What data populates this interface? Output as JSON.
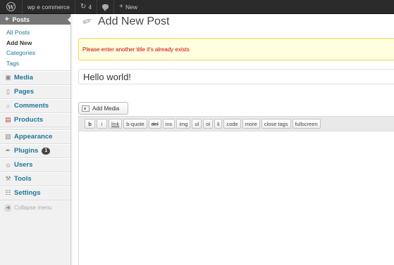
{
  "adminbar": {
    "site_name": "wp e commerce",
    "updates_count": "4",
    "new_label": "New"
  },
  "sidebar": {
    "posts_label": "Posts",
    "posts_submenu": [
      {
        "label": "All Posts"
      },
      {
        "label": "Add New"
      },
      {
        "label": "Categories"
      },
      {
        "label": "Tags"
      }
    ],
    "items": [
      {
        "label": "Media",
        "icon": "media-icon"
      },
      {
        "label": "Pages",
        "icon": "pages-icon"
      },
      {
        "label": "Comments",
        "icon": "comments-icon"
      },
      {
        "label": "Products",
        "icon": "products-icon"
      },
      {
        "label": "Appearance",
        "icon": "appearance-icon"
      },
      {
        "label": "Plugins",
        "icon": "plugins-icon",
        "badge": "1"
      },
      {
        "label": "Users",
        "icon": "users-icon"
      },
      {
        "label": "Tools",
        "icon": "tools-icon"
      },
      {
        "label": "Settings",
        "icon": "settings-icon"
      }
    ],
    "collapse_label": "Collapse menu"
  },
  "main": {
    "page_title": "Add New Post",
    "notice": "Please enter another title it's already exists",
    "post_title_value": "Hello world!",
    "add_media_label": "Add Media",
    "quicktags": [
      "b",
      "i",
      "link",
      "b-quote",
      "del",
      "ins",
      "img",
      "ul",
      "ol",
      "li",
      "code",
      "more",
      "close tags",
      "fullscreen"
    ]
  },
  "colors": {
    "adminbar_bg": "#2a2a2a",
    "link_blue": "#21759b",
    "notice_bg": "#ffffe0",
    "notice_text": "#cc0000"
  }
}
